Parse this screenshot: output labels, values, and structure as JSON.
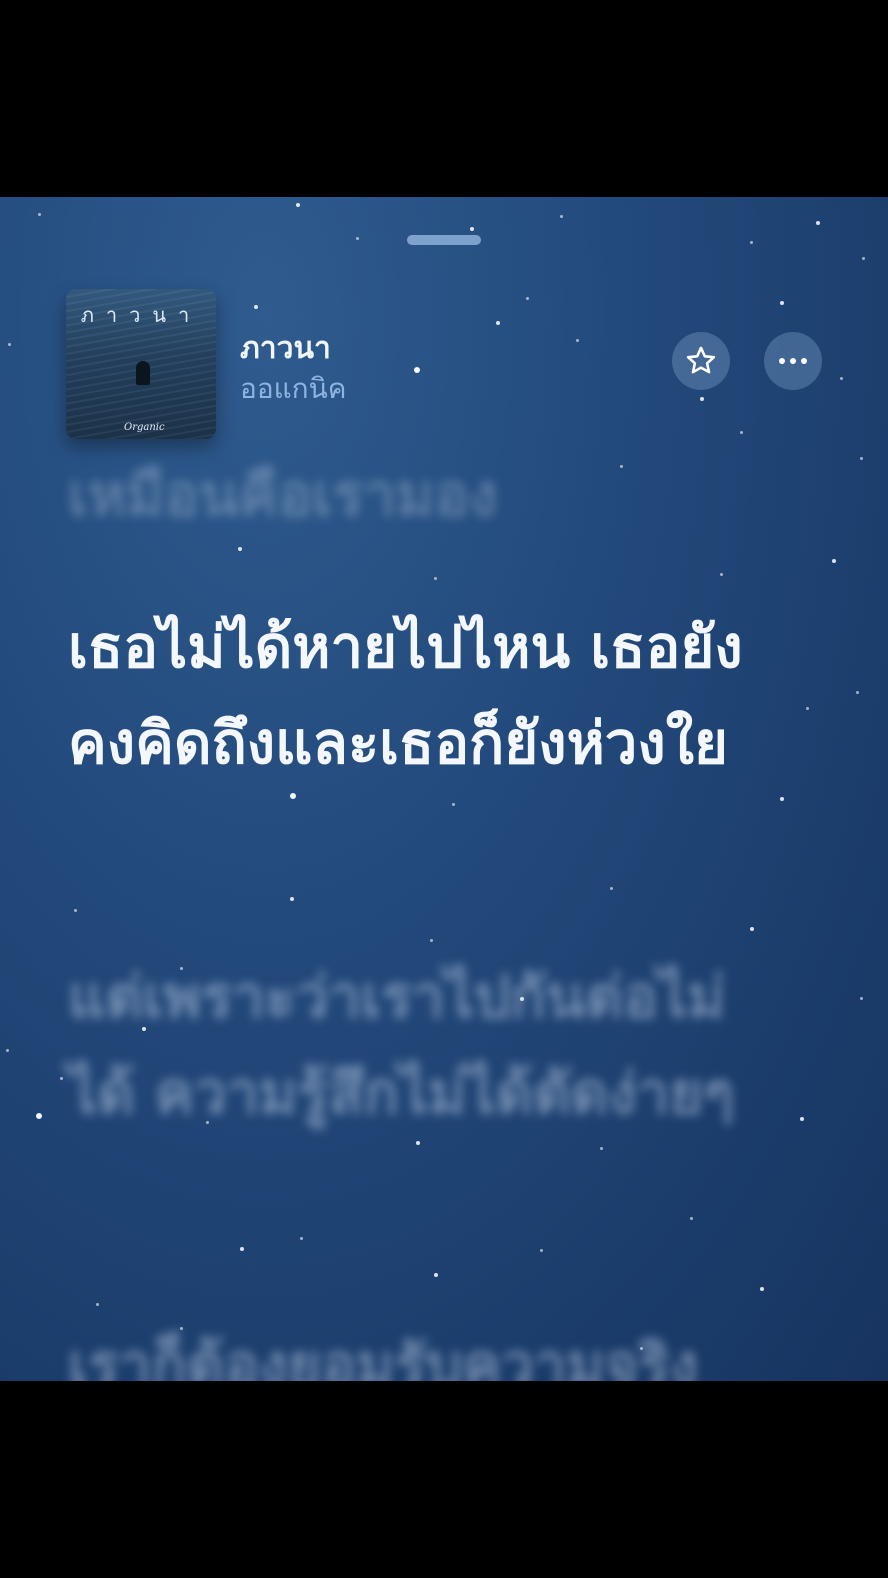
{
  "song": {
    "title": "ภาวนา",
    "artist": "ออแกนิค",
    "artwork": {
      "title_text": "ภาวนา",
      "signature": "Organic"
    }
  },
  "actions": {
    "favorite_icon": "star-outline-icon",
    "more_icon": "ellipsis-icon"
  },
  "lyrics": {
    "previous": "เหมือนคือเรามอง",
    "active": "เธอไม่ได้หายไปไหน เธอยังคงคิดถึงและเธอก็ยังห่วงใย",
    "next": "แต่เพราะว่าเราไปกันต่อไม่ได้ ความรู้สึกไม่ได้ตัดง่ายๆ",
    "after": "เราก็ต้องยอมรับความจริง"
  },
  "colors": {
    "background": "#234a7c",
    "active_lyric": "#f4f8fc",
    "artist": "#8fb4e2"
  }
}
